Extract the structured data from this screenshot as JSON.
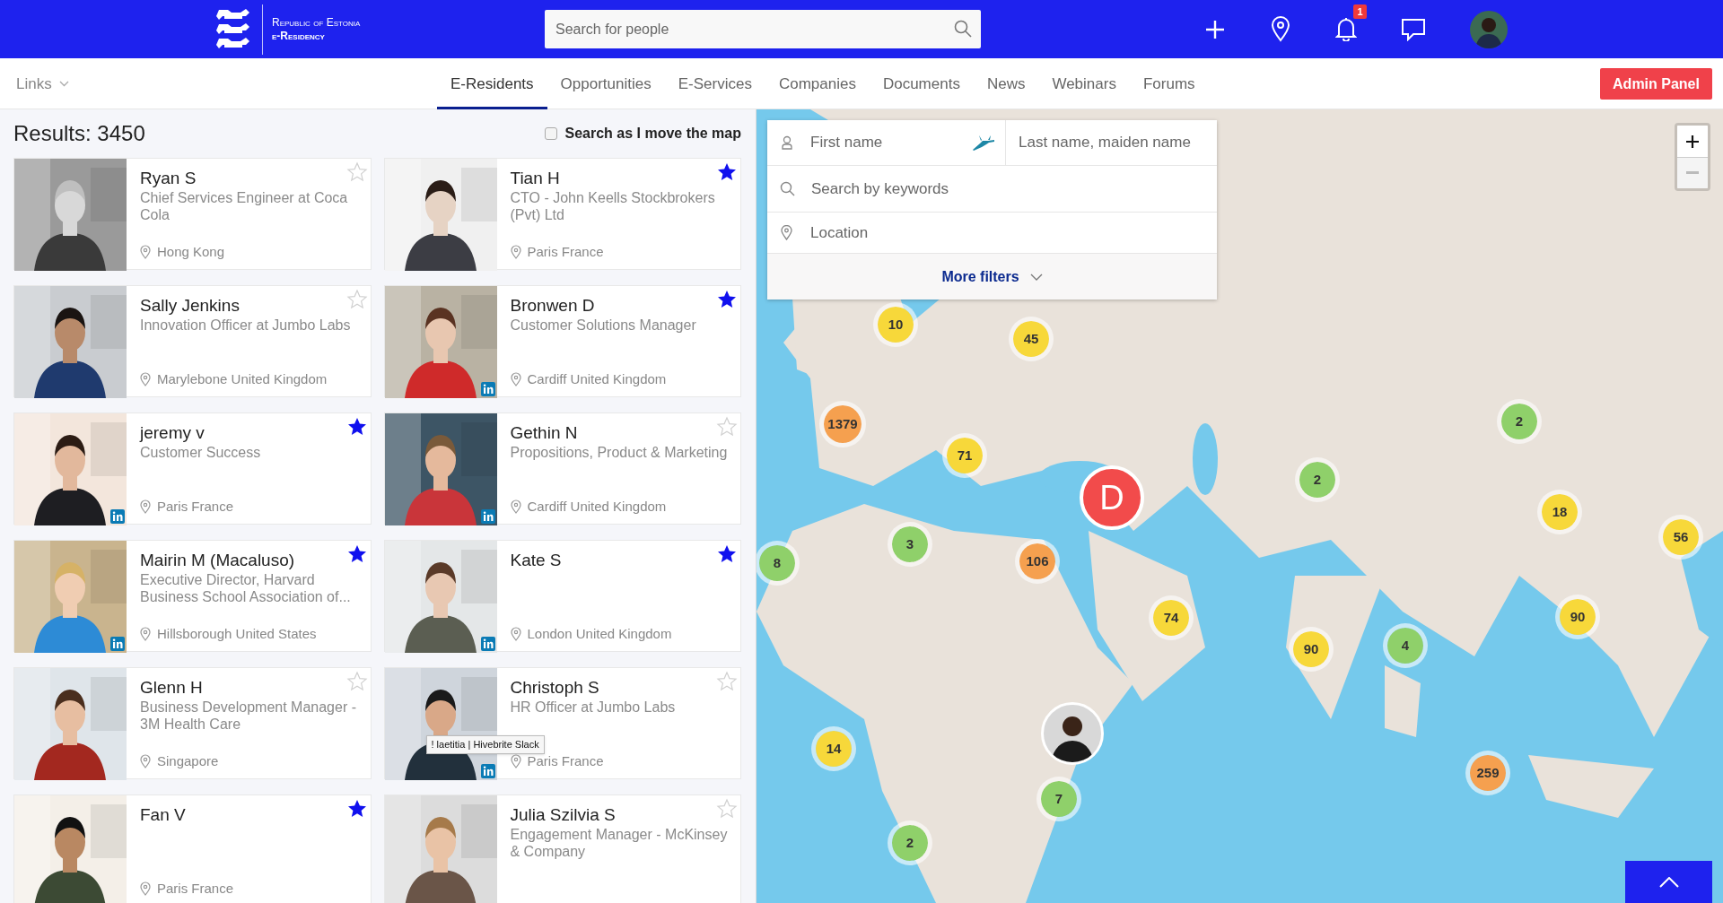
{
  "header": {
    "logo_lines": [
      "Republic of Estonia",
      "e-Residency"
    ],
    "search": {
      "placeholder": "Search for people"
    },
    "notifications_badge": "1"
  },
  "nav": {
    "links_menu": "Links",
    "tabs": [
      {
        "label": "E-Residents",
        "selected": true
      },
      {
        "label": "Opportunities",
        "selected": false
      },
      {
        "label": "E-Services",
        "selected": false
      },
      {
        "label": "Companies",
        "selected": false
      },
      {
        "label": "Documents",
        "selected": false
      },
      {
        "label": "News",
        "selected": false
      },
      {
        "label": "Webinars",
        "selected": false
      },
      {
        "label": "Forums",
        "selected": false
      }
    ],
    "admin_button": "Admin Panel"
  },
  "results": {
    "count": "Results: 3450",
    "map_search": {
      "label": "Search as I move the map",
      "checked": false
    },
    "people": [
      {
        "name": "Ryan S",
        "title": "Chief Services Engineer at Coca Cola",
        "location": "Hong Kong",
        "starred": false,
        "linkedin": false
      },
      {
        "name": "Tian H",
        "title": "CTO - John Keells Stockbrokers (Pvt) Ltd",
        "location": "Paris France",
        "starred": true,
        "linkedin": false
      },
      {
        "name": "Sally Jenkins",
        "title": "Innovation Officer at Jumbo Labs",
        "location": "Marylebone United Kingdom",
        "starred": false,
        "linkedin": false
      },
      {
        "name": "Bronwen D",
        "title": "Customer Solutions Manager",
        "location": "Cardiff United Kingdom",
        "starred": true,
        "linkedin": true
      },
      {
        "name": "jeremy v",
        "title": "Customer Success",
        "location": "Paris France",
        "starred": true,
        "linkedin": true
      },
      {
        "name": "Gethin N",
        "title": "Propositions, Product & Marketing",
        "location": "Cardiff United Kingdom",
        "starred": false,
        "linkedin": true
      },
      {
        "name": "Mairin M (Macaluso)",
        "title": "Executive Director, Harvard Business School Association of...",
        "location": "Hillsborough United States",
        "starred": true,
        "linkedin": true
      },
      {
        "name": "Kate S",
        "location": "London United Kingdom",
        "starred": true,
        "linkedin": true
      },
      {
        "name": "Glenn H",
        "title": "Business Development Manager - 3M Health Care",
        "location": "Singapore",
        "starred": false,
        "linkedin": false
      },
      {
        "name": "Christoph S",
        "title": "HR Officer at Jumbo Labs",
        "location": "Paris France",
        "starred": false,
        "linkedin": true,
        "tooltip": "! laetitia | Hivebrite Slack"
      },
      {
        "name": "Fan V",
        "location": "Paris France",
        "starred": true,
        "linkedin": false
      },
      {
        "name": "Julia Szilvia S",
        "title": "Engagement Manager - McKinsey & Company",
        "starred": false,
        "linkedin": false
      }
    ]
  },
  "filters": {
    "first_name": {
      "placeholder": "First name"
    },
    "last_name": {
      "placeholder": "Last name, maiden name"
    },
    "keywords": {
      "placeholder": "Search by keywords"
    },
    "location": {
      "placeholder": "Location"
    },
    "more": "More filters"
  },
  "map": {
    "zoom_out_disabled": true,
    "markers": [
      {
        "kind": "cluster",
        "label": "10",
        "color": "#f7d83a"
      },
      {
        "kind": "cluster",
        "label": "45",
        "color": "#f7d83a"
      },
      {
        "kind": "cluster",
        "label": "2",
        "color": "#8fd06a"
      },
      {
        "kind": "cluster",
        "label": "1379",
        "color": "#f5a04f"
      },
      {
        "kind": "cluster",
        "label": "71",
        "color": "#f7d83a"
      },
      {
        "kind": "cluster",
        "label": "2",
        "color": "#8fd06a"
      },
      {
        "kind": "letter",
        "label": "D",
        "color": "#f24b4b"
      },
      {
        "kind": "cluster",
        "label": "18",
        "color": "#f7d83a"
      },
      {
        "kind": "cluster",
        "label": "56",
        "color": "#f7d83a"
      },
      {
        "kind": "cluster",
        "label": "3",
        "color": "#8fd06a"
      },
      {
        "kind": "cluster",
        "label": "106",
        "color": "#f5a04f"
      },
      {
        "kind": "cluster",
        "label": "8",
        "color": "#8fd06a"
      },
      {
        "kind": "cluster",
        "label": "90",
        "color": "#f7d83a"
      },
      {
        "kind": "cluster",
        "label": "74",
        "color": "#f7d83a"
      },
      {
        "kind": "cluster",
        "label": "4",
        "color": "#8fd06a"
      },
      {
        "kind": "cluster",
        "label": "90",
        "color": "#f7d83a"
      },
      {
        "kind": "avatar"
      },
      {
        "kind": "cluster",
        "label": "14",
        "color": "#f7d83a"
      },
      {
        "kind": "cluster",
        "label": "259",
        "color": "#f5a04f"
      },
      {
        "kind": "cluster",
        "label": "7",
        "color": "#8fd06a"
      },
      {
        "kind": "cluster",
        "label": "2",
        "color": "#8fd06a"
      }
    ]
  }
}
